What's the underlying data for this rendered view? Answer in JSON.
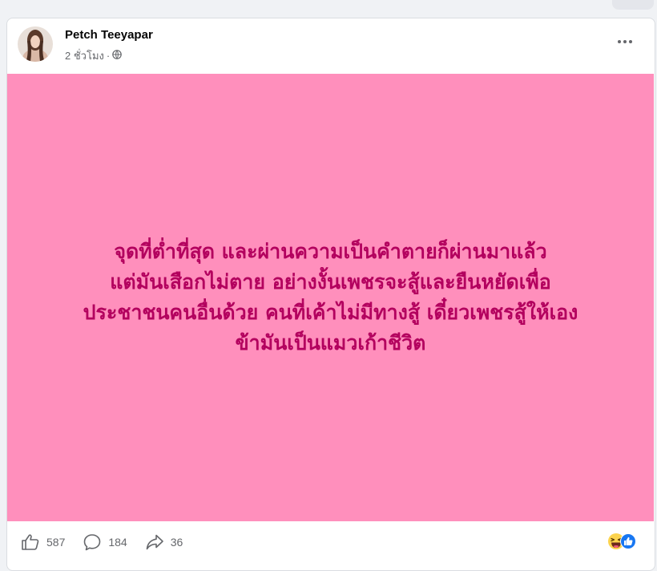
{
  "post": {
    "author": "Petch Teeyapar",
    "time": "2 ชั่วโมง",
    "separator": "·",
    "text_lines": [
      "จุดที่ต่ำที่สุด และผ่านความเป็นคำตายก็ผ่านมาแล้ว",
      "แต่มันเสือกไม่ตาย อย่างงั้นเพชรจะสู้และยืนหยัดเพื่อ",
      "ประชาชนคนอื่นด้วย คนที่เค้าไม่มีทางสู้ เดี๋ยวเพชรสู้ให้เอง",
      "ข้ามันเป็นแมวเก้าชีวิต"
    ],
    "background_color": "#ff8fbc",
    "text_color": "#b3005e"
  },
  "stats": {
    "likes": "587",
    "comments": "184",
    "shares": "36"
  },
  "icons": {
    "privacy": "globe-icon",
    "more": "more-options-icon",
    "like": "like-icon",
    "comment": "comment-icon",
    "share": "share-icon",
    "reaction_haha": "haha-reaction-icon",
    "reaction_like": "like-reaction-icon"
  }
}
